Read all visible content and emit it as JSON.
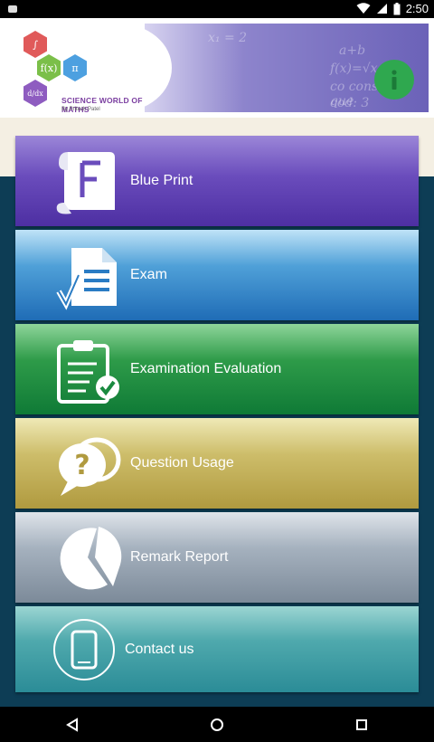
{
  "status_bar": {
    "time": "2:50"
  },
  "header": {
    "brand_title": "SCIENCE WORLD OF MATHS",
    "brand_subtitle": "By Pritesh Patel",
    "hex_labels": [
      "∫",
      "f(x)",
      "π",
      "d/dx"
    ],
    "banner_math": [
      "x₁ = 2",
      "a+b",
      "f(x)=√x",
      "co considère que",
      "cod: 3"
    ]
  },
  "menu": {
    "items": [
      {
        "label": "Blue Print",
        "icon": "blueprint-scroll-icon"
      },
      {
        "label": "Exam",
        "icon": "exam-document-icon"
      },
      {
        "label": "Examination Evaluation",
        "icon": "clipboard-check-icon"
      },
      {
        "label": "Question Usage",
        "icon": "question-bubbles-icon"
      },
      {
        "label": "Remark Report",
        "icon": "pie-chart-icon"
      },
      {
        "label": "Contact us",
        "icon": "phone-icon"
      }
    ]
  },
  "colors": {
    "accent_green": "#2fa84f",
    "item_bg": [
      "#5a3cb0",
      "#2a7cc4",
      "#1a8a3f",
      "#bba752",
      "#8c99a8",
      "#3a97a0"
    ]
  }
}
